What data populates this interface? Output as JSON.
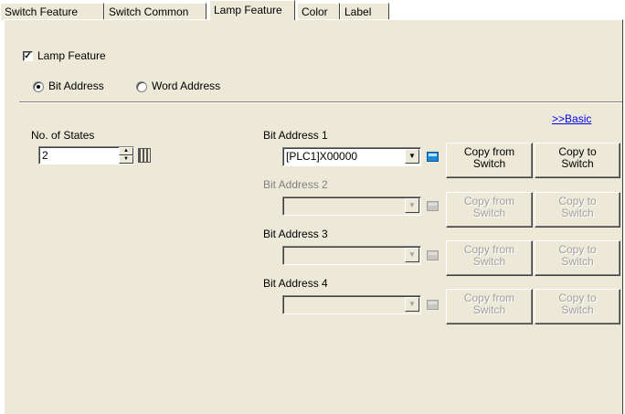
{
  "tabs": [
    "Switch Feature",
    "Switch Common",
    "Lamp Feature",
    "Color",
    "Label"
  ],
  "lamp_feature": {
    "label": "Lamp Feature",
    "checked": true
  },
  "address_type": {
    "bit": "Bit Address",
    "word": "Word Address",
    "selected": "bit"
  },
  "basic_link": ">>Basic",
  "states": {
    "label": "No. of States",
    "value": "2"
  },
  "bit_addresses": [
    {
      "label": "Bit Address 1",
      "value": "[PLC1]X00000",
      "enabled": true
    },
    {
      "label": "Bit Address 2",
      "value": "",
      "enabled": false
    },
    {
      "label": "Bit Address 3",
      "value": "",
      "enabled": false
    },
    {
      "label": "Bit Address 4",
      "value": "",
      "enabled": false
    }
  ],
  "copy_from": "Copy from\nSwitch",
  "copy_to": "Copy to\nSwitch",
  "icons": {
    "dropdown": "chevron-down-icon",
    "picker": "address-picker-icon",
    "keypad": "keypad-icon",
    "spin": "spinner-icon"
  }
}
